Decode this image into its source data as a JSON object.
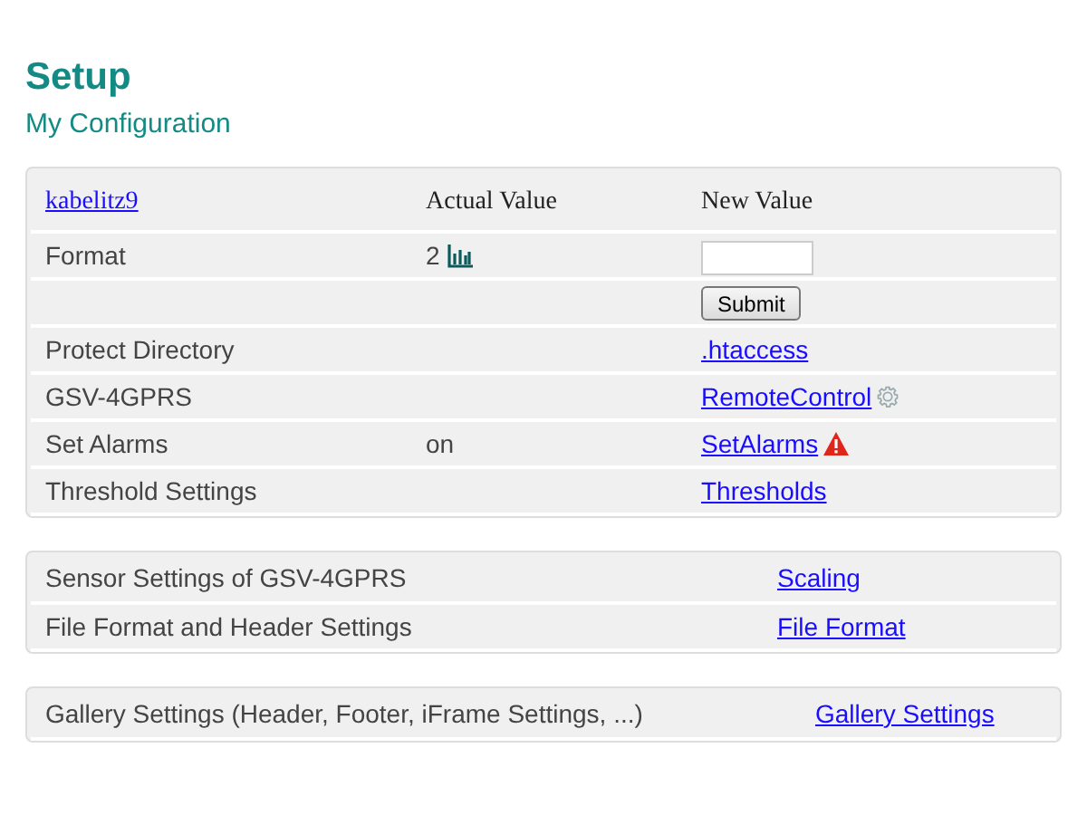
{
  "title": "Setup",
  "subtitle": "My Configuration",
  "config_table": {
    "header": {
      "name": "kabelitz9",
      "actual": "Actual Value",
      "new": "New Value"
    },
    "rows": [
      {
        "label": "Format",
        "actual": {
          "kind": "chart",
          "text": "2"
        },
        "new": {
          "kind": "input"
        }
      },
      {
        "new": {
          "kind": "button",
          "text": "Submit"
        }
      },
      {
        "label": "Protect Directory",
        "new": {
          "kind": "link",
          "text": ".htaccess"
        }
      },
      {
        "label": "GSV-4GPRS",
        "new": {
          "kind": "settingslink",
          "text": "RemoteControl"
        }
      },
      {
        "label": "Set Alarms",
        "actual": {
          "kind": "text",
          "text": "on"
        },
        "new": {
          "kind": "alertlink",
          "text": "SetAlarms"
        }
      },
      {
        "label": "Threshold Settings",
        "new": {
          "kind": "link",
          "text": "Thresholds"
        }
      }
    ]
  },
  "sensor_table": {
    "rows": [
      {
        "label": "Sensor Settings of GSV-4GPRS",
        "link": "Scaling"
      },
      {
        "label": "File Format and Header Settings",
        "link": "File Format"
      }
    ]
  },
  "gallery_table": {
    "rows": [
      {
        "label": "Gallery Settings (Header, Footer, iFrame Settings, ...)",
        "link": "Gallery Settings"
      }
    ]
  }
}
